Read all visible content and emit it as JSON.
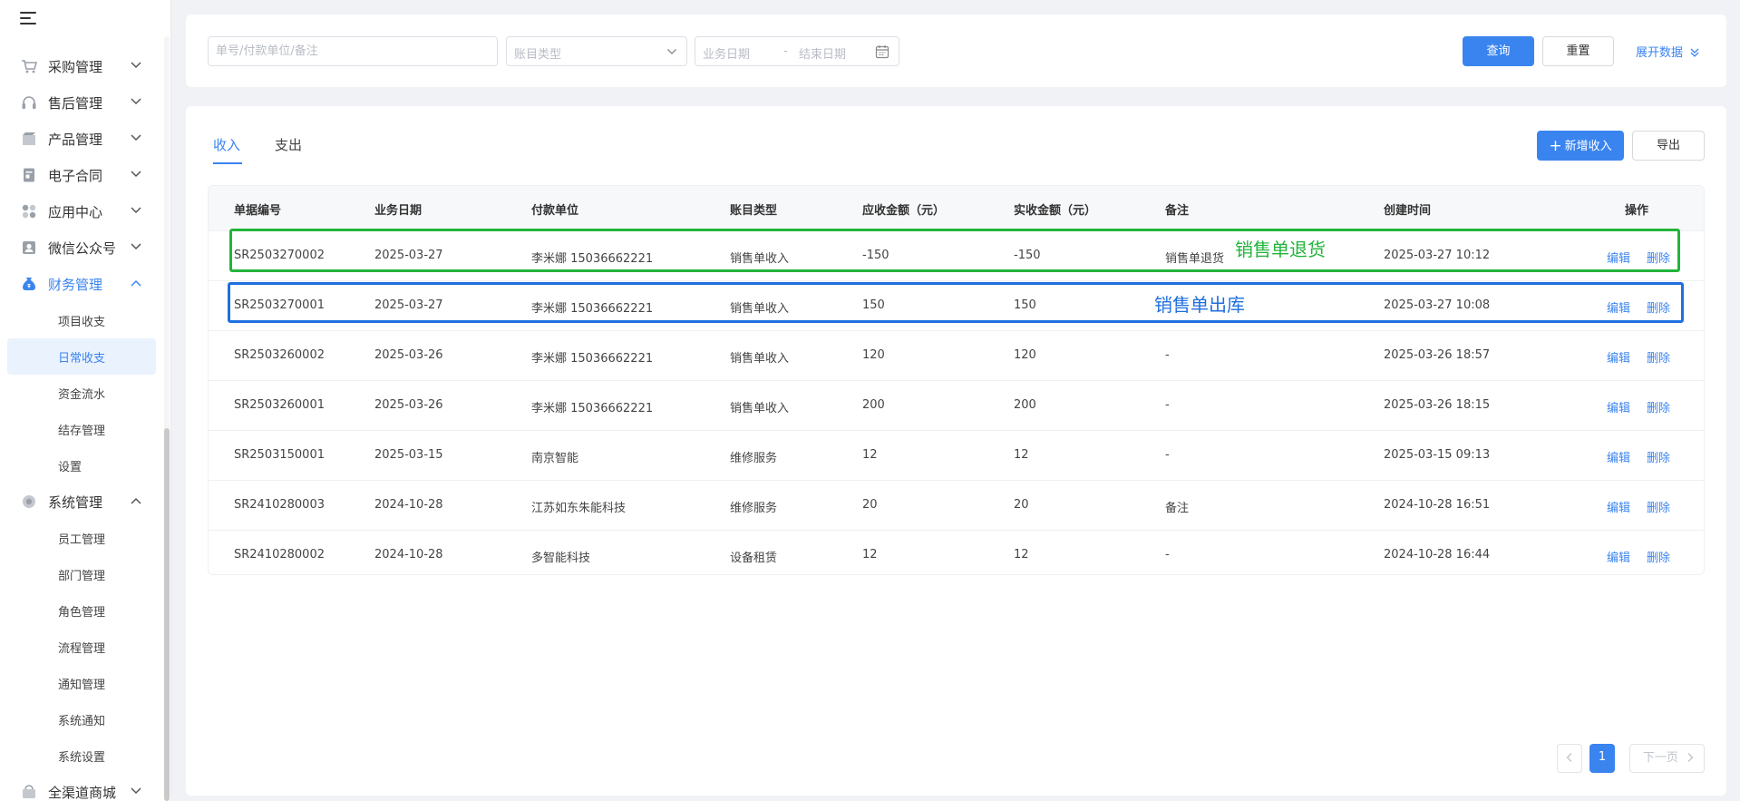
{
  "sidebar": {
    "groups": [
      {
        "label": "采购管理",
        "icon": "cart-icon",
        "expanded": false
      },
      {
        "label": "售后管理",
        "icon": "headset-icon",
        "expanded": false
      },
      {
        "label": "产品管理",
        "icon": "box-icon",
        "expanded": false
      },
      {
        "label": "电子合同",
        "icon": "contract-icon",
        "expanded": false
      },
      {
        "label": "应用中心",
        "icon": "apps-icon",
        "expanded": false
      },
      {
        "label": "微信公众号",
        "icon": "user-card-icon",
        "expanded": false
      },
      {
        "label": "财务管理",
        "icon": "money-bag-icon",
        "expanded": true,
        "active": true
      },
      {
        "label": "系统管理",
        "icon": "gear-icon",
        "expanded": true
      },
      {
        "label": "全渠道商城",
        "icon": "shop-icon",
        "expanded": false
      }
    ],
    "finance_items": [
      "项目收支",
      "日常收支",
      "资金流水",
      "结存管理",
      "设置"
    ],
    "system_items": [
      "员工管理",
      "部门管理",
      "角色管理",
      "流程管理",
      "通知管理",
      "系统通知",
      "系统设置"
    ],
    "selected_item": "日常收支"
  },
  "filters": {
    "keyword_placeholder": "单号/付款单位/备注",
    "type_placeholder": "账目类型",
    "start_date_placeholder": "业务日期",
    "date_separator": "-",
    "end_date_placeholder": "结束日期",
    "query_label": "查询",
    "reset_label": "重置",
    "expand_label": "展开数据"
  },
  "tabs": {
    "income": "收入",
    "expense": "支出"
  },
  "actions": {
    "add_label": "新增收入",
    "export_label": "导出"
  },
  "table": {
    "headers": [
      "单据编号",
      "业务日期",
      "付款单位",
      "账目类型",
      "应收金额（元）",
      "实收金额（元）",
      "备注",
      "创建时间",
      "操作"
    ],
    "edit_label": "编辑",
    "delete_label": "删除",
    "rows": [
      {
        "no": "SR2503270002",
        "date": "2025-03-27",
        "payer": "李米娜 15036662221",
        "type": "销售单收入",
        "receivable": "-150",
        "received": "-150",
        "remark": "销售单退货",
        "created": "2025-03-27 10:12"
      },
      {
        "no": "SR2503270001",
        "date": "2025-03-27",
        "payer": "李米娜 15036662221",
        "type": "销售单收入",
        "receivable": "150",
        "received": "150",
        "remark": "",
        "created": "2025-03-27 10:08"
      },
      {
        "no": "SR2503260002",
        "date": "2025-03-26",
        "payer": "李米娜 15036662221",
        "type": "销售单收入",
        "receivable": "120",
        "received": "120",
        "remark": "-",
        "created": "2025-03-26 18:57"
      },
      {
        "no": "SR2503260001",
        "date": "2025-03-26",
        "payer": "李米娜 15036662221",
        "type": "销售单收入",
        "receivable": "200",
        "received": "200",
        "remark": "-",
        "created": "2025-03-26 18:15"
      },
      {
        "no": "SR2503150001",
        "date": "2025-03-15",
        "payer": "南京智能",
        "type": "维修服务",
        "receivable": "12",
        "received": "12",
        "remark": "-",
        "created": "2025-03-15 09:13"
      },
      {
        "no": "SR2410280003",
        "date": "2024-10-28",
        "payer": "江苏如东朱能科技",
        "type": "维修服务",
        "receivable": "20",
        "received": "20",
        "remark": "备注",
        "created": "2024-10-28 16:51"
      },
      {
        "no": "SR2410280002",
        "date": "2024-10-28",
        "payer": "多智能科技",
        "type": "设备租赁",
        "receivable": "12",
        "received": "12",
        "remark": "-",
        "created": "2024-10-28 16:44"
      }
    ]
  },
  "annotations": {
    "return_note": "销售单退货",
    "outbound_note": "销售单出库",
    "return_color": "#22b43c",
    "outbound_color": "#1f6fe0"
  },
  "pagination": {
    "current_page": "1",
    "next_label": "下一页"
  },
  "colors": {
    "accent": "#3a84f0",
    "background": "#f0f2f5"
  }
}
